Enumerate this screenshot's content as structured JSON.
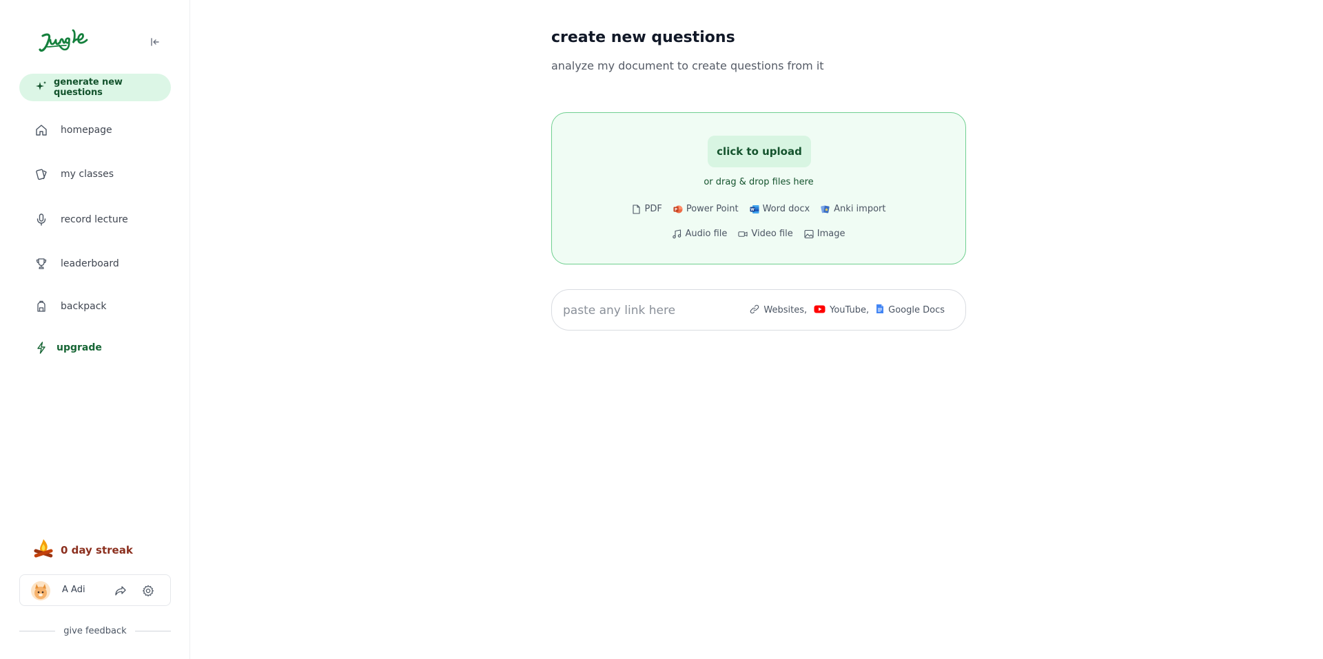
{
  "sidebar": {
    "generate_label": "generate new questions",
    "items": [
      {
        "label": "homepage"
      },
      {
        "label": "my classes"
      },
      {
        "label": "record lecture"
      },
      {
        "label": "leaderboard"
      },
      {
        "label": "backpack"
      },
      {
        "label": "upgrade"
      }
    ],
    "streak": "0 day streak",
    "user_name": "A Adi",
    "feedback": "give feedback"
  },
  "main": {
    "title": "create new questions",
    "subtitle": "analyze my document to create questions from it",
    "upload": {
      "button": "click to upload",
      "drop_text": "or drag & drop files here",
      "types_row1": [
        "PDF",
        "Power Point",
        "Word docx",
        "Anki import"
      ],
      "types_row2": [
        "Audio file",
        "Video file",
        "Image"
      ]
    },
    "link": {
      "placeholder": "paste any link here",
      "sources": [
        "Websites,",
        "YouTube,",
        "Google Docs"
      ]
    }
  },
  "colors": {
    "accent_green": "#166534",
    "upload_border": "#6fcf8f",
    "upload_bg": "#f0fcf4",
    "streak_text": "#8b2f1e"
  }
}
